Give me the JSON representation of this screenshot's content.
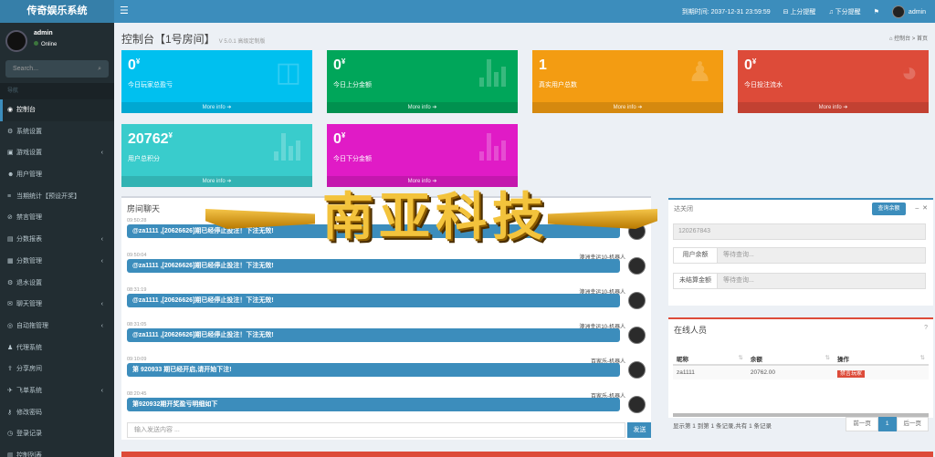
{
  "app": {
    "title": "传奇娱乐系统"
  },
  "topbar": {
    "expiry": "到期时间: 2037-12-31 23:59:59",
    "up_alert": "上分提醒",
    "down_alert": "下分提醒",
    "user": "admin"
  },
  "user": {
    "name": "admin",
    "status": "Online"
  },
  "search": {
    "placeholder": "Search..."
  },
  "nav": {
    "header": "导航",
    "items": [
      {
        "label": "控制台",
        "icon": "dashboard-icon",
        "arrow": false,
        "active": true
      },
      {
        "label": "系统设置",
        "icon": "gear-icon",
        "arrow": false
      },
      {
        "label": "游戏设置",
        "icon": "gamepad-icon",
        "arrow": true
      },
      {
        "label": "用户管理",
        "icon": "users-icon",
        "arrow": false
      },
      {
        "label": "当期统计【预设开奖】",
        "icon": "list-icon",
        "arrow": false
      },
      {
        "label": "禁言管理",
        "icon": "ban-icon",
        "arrow": false
      },
      {
        "label": "分数报表",
        "icon": "report-icon",
        "arrow": true
      },
      {
        "label": "分数管理",
        "icon": "score-icon",
        "arrow": true
      },
      {
        "label": "退水设置",
        "icon": "settings-icon",
        "arrow": false
      },
      {
        "label": "聊天管理",
        "icon": "chat-icon",
        "arrow": true
      },
      {
        "label": "自动拖管理",
        "icon": "robot-icon",
        "arrow": true
      },
      {
        "label": "代理系统",
        "icon": "agent-icon",
        "arrow": false
      },
      {
        "label": "分享房间",
        "icon": "share-icon",
        "arrow": false
      },
      {
        "label": "飞单系统",
        "icon": "plane-icon",
        "arrow": true
      },
      {
        "label": "修改密码",
        "icon": "key-icon",
        "arrow": false
      },
      {
        "label": "登录记录",
        "icon": "record-icon",
        "arrow": false
      },
      {
        "label": "控制列表",
        "icon": "control-icon",
        "arrow": false
      }
    ]
  },
  "page": {
    "title": "控制台【1号房间】",
    "version": "V 5.0.1 高级定制版",
    "crumb_home": "控制台",
    "crumb_current": "首页"
  },
  "stats": [
    {
      "value": "0",
      "unit": "¥",
      "label": "今日玩家总盈亏",
      "more": "More info",
      "color": "#00c0ef",
      "icon": "bag-icon"
    },
    {
      "value": "0",
      "unit": "¥",
      "label": "今日上分金额",
      "more": "More info",
      "color": "#00a65a",
      "icon": "bar-chart-icon"
    },
    {
      "value": "1",
      "unit": "",
      "label": "真实用户总数",
      "more": "More info",
      "color": "#f39c12",
      "icon": "user-plus-icon"
    },
    {
      "value": "0",
      "unit": "¥",
      "label": "今日投注流水",
      "more": "More info",
      "color": "#dd4b39",
      "icon": "pie-chart-icon"
    },
    {
      "value": "20762",
      "unit": "¥",
      "label": "用户总积分",
      "more": "More info",
      "color": "#39cccc",
      "icon": "bar-chart-icon"
    },
    {
      "value": "0",
      "unit": "¥",
      "label": "今日下分金额",
      "more": "More info",
      "color": "#e01bc6",
      "icon": "bar-chart-icon"
    }
  ],
  "chat": {
    "title": "房间聊天",
    "messages": [
      {
        "time": "09:50:28",
        "sender": "器人",
        "text": "@za1111 ,[20626626]期已经停止投注！下注无效!"
      },
      {
        "time": "09:50:04",
        "sender": "澳洲幸运10-机器人",
        "text": "@za1111 ,[20626626]期已经停止投注！下注无效!"
      },
      {
        "time": "08:31:19",
        "sender": "澳洲幸运10-机器人",
        "text": "@za1111 ,[20626626]期已经停止投注！下注无效!"
      },
      {
        "time": "08:31:05",
        "sender": "澳洲幸运10-机器人",
        "text": "@za1111 ,[20626626]期已经停止投注！下注无效!"
      },
      {
        "time": "09:10:09",
        "sender": "百家乐-机器人",
        "text": "第 920933 期已经开启,请开始下注!"
      },
      {
        "time": "08:20:45",
        "sender": "百家乐-机器人",
        "text": "第920932期开奖盈亏明细如下"
      }
    ],
    "input_placeholder": "输入发送内容 ...",
    "send_label": "发送"
  },
  "query": {
    "title": "达关闭",
    "button": "查询余额",
    "id_value": "120267843",
    "rows": [
      {
        "label": "用户余额",
        "value": "等待查询..."
      },
      {
        "label": "未结算金额",
        "value": "等待查询..."
      }
    ]
  },
  "online": {
    "title": "在线人员",
    "columns": [
      "昵称",
      "余额",
      "操作"
    ],
    "rows": [
      {
        "nick": "za1111",
        "balance": "20762.00",
        "action": "禁言玩家"
      }
    ],
    "info": "显示第 1 到第 1 条记录,共有 1 条记录",
    "prev": "前一页",
    "page": "1",
    "next": "后一页"
  },
  "watermark": {
    "text": "南亚科技"
  }
}
